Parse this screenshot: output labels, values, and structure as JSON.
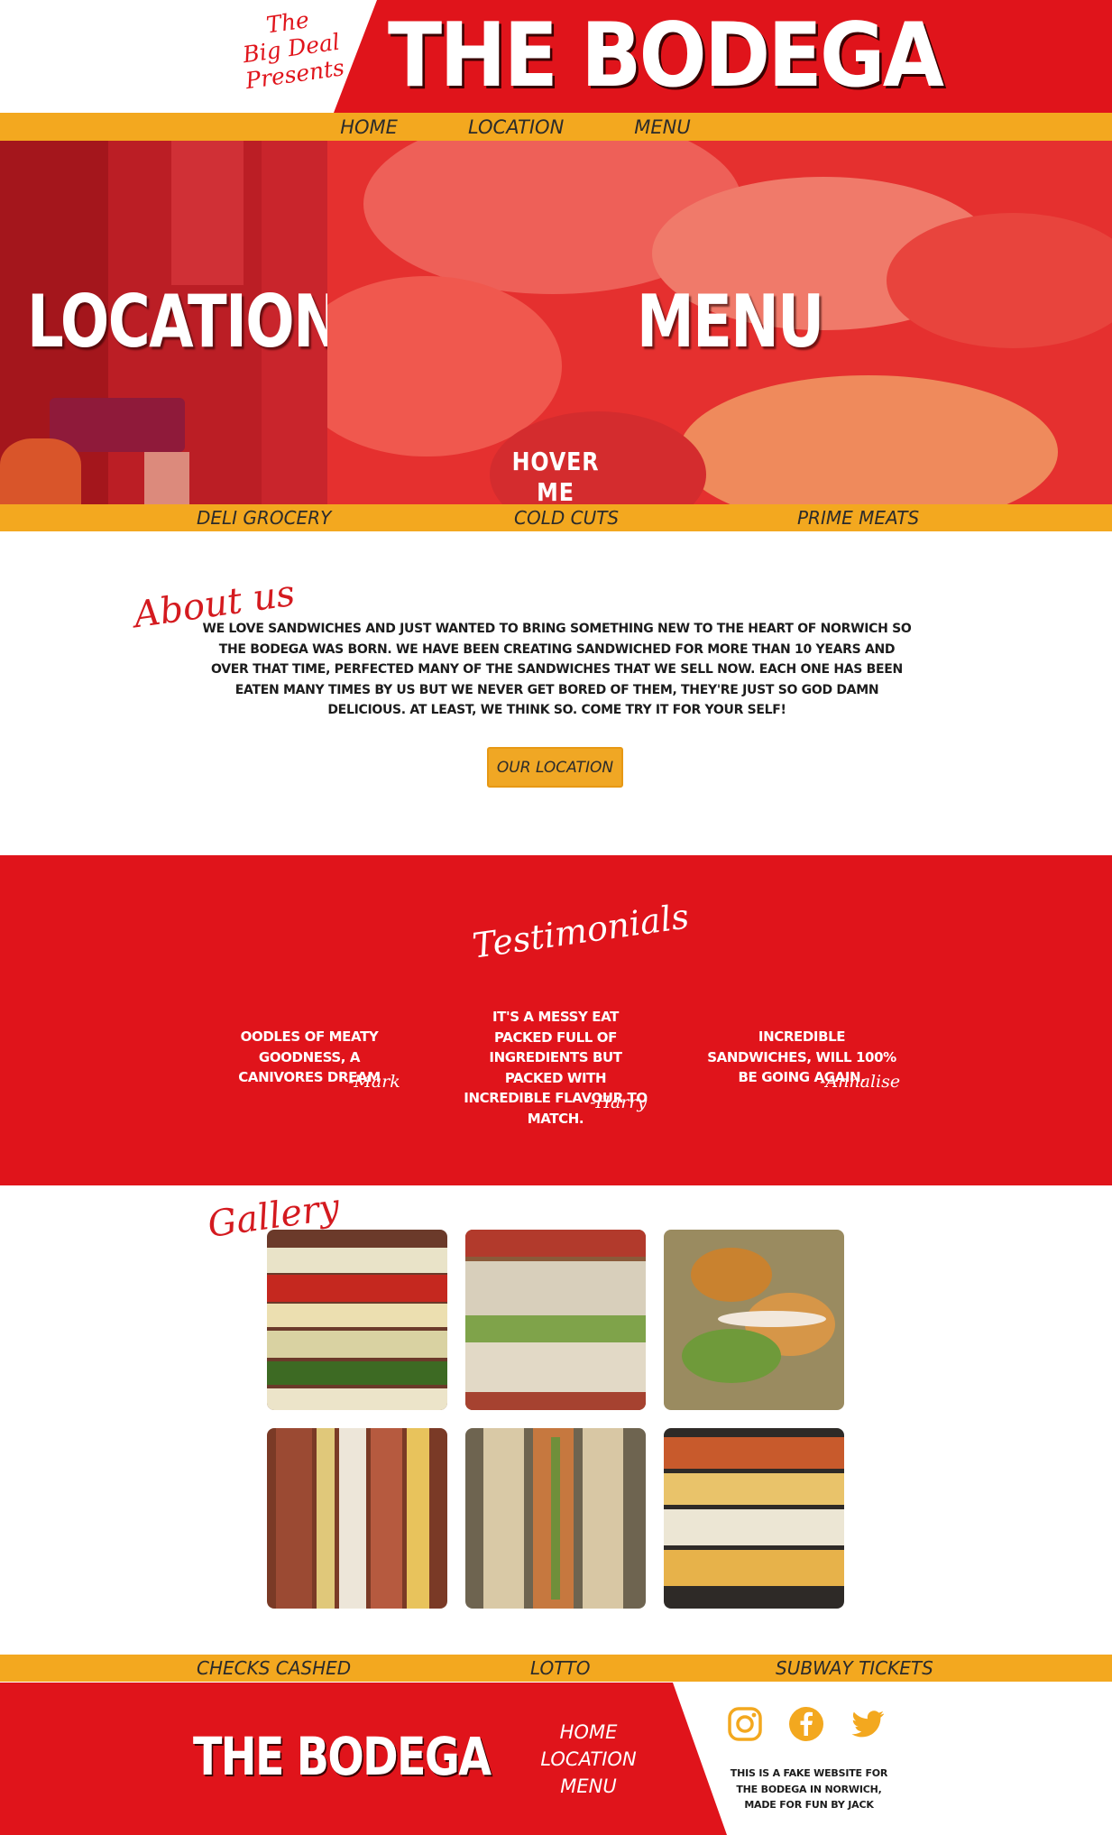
{
  "header": {
    "tagline": [
      "The",
      "Big Deal",
      "Presents"
    ],
    "brand": "THE BODEGA"
  },
  "nav": {
    "items": [
      "HOME",
      "LOCATION",
      "MENU"
    ]
  },
  "hero": {
    "left_label": "LOCATION",
    "right_label": "MENU",
    "hover_label": "HOVER ME"
  },
  "strip_top": {
    "items": [
      "DELI GROCERY",
      "COLD CUTS",
      "PRIME MEATS"
    ]
  },
  "about": {
    "title": "About us",
    "text": "We love sandwiches and just wanted to bring something new to the heart of Norwich so The Bodega was born. We have been creating sandwiched for more than 10 years and over that time, perfected many of the sandwiches that we sell now. Each one has been eaten many times by us but we never get bored of them, they're just so god damn delicious. At least, we think so. Come try it for your self!",
    "button": "OUR LOCATION"
  },
  "testimonials": {
    "title": "Testimonials",
    "items": [
      {
        "quote": "Oodles of meaty goodness, a canivores dream",
        "author": "-Mark"
      },
      {
        "quote": "It's a messy eat packed full of ingredients but packed with incredible flavour to match.",
        "author": "-Harry"
      },
      {
        "quote": "Incredible sandwiches, will 100% be going again.",
        "author": "-Annalise"
      }
    ]
  },
  "gallery": {
    "title": "Gallery",
    "photos": [
      "sandwich-photo-1",
      "sandwich-photo-2",
      "sandwich-photo-3",
      "sandwich-photo-4",
      "sandwich-photo-5",
      "sandwich-photo-6"
    ]
  },
  "strip_bottom": {
    "items": [
      "CHECKS CASHED",
      "LOTTO",
      "SUBWAY TICKETS"
    ]
  },
  "footer": {
    "brand": "THE BODEGA",
    "nav": [
      "HOME",
      "LOCATION",
      "MENU"
    ],
    "social_icons": [
      "instagram-icon",
      "facebook-icon",
      "twitter-icon"
    ],
    "note": "This is a fake website for the Bodega in Norwich, made for fun by Jack"
  },
  "colors": {
    "brand_red": "#e0141b",
    "accent_yellow": "#f3a81f",
    "white": "#ffffff"
  }
}
